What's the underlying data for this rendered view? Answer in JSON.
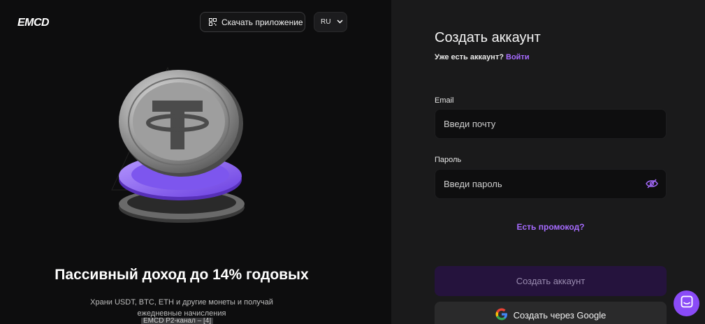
{
  "header": {
    "logo_text": "EMCD",
    "download_label": "Скачать приложение",
    "language": "RU"
  },
  "promo": {
    "title": "Пассивный доход до 14% годовых",
    "text": "Храни USDT, BTC, ETH и другие монеты и получай ежедневные начисления",
    "tooltip": "EMCD P2-канал – [4]"
  },
  "form": {
    "title": "Создать аккаунт",
    "have_account": "Уже есть аккаунт?",
    "login_link": "Войти",
    "email_label": "Email",
    "email_placeholder": "Введи почту",
    "password_label": "Пароль",
    "password_placeholder": "Введи пароль",
    "promo_code_link": "Есть промокод?",
    "create_button": "Создать аккаунт",
    "google_button": "Создать через Google"
  },
  "colors": {
    "accent": "#a66bff",
    "create_button_bg": "#25133d",
    "chat_button": "#8a4bf7"
  },
  "icons": [
    "qr-code-icon",
    "chevron-down-icon",
    "eye-off-icon",
    "google-icon",
    "chat-icon"
  ]
}
